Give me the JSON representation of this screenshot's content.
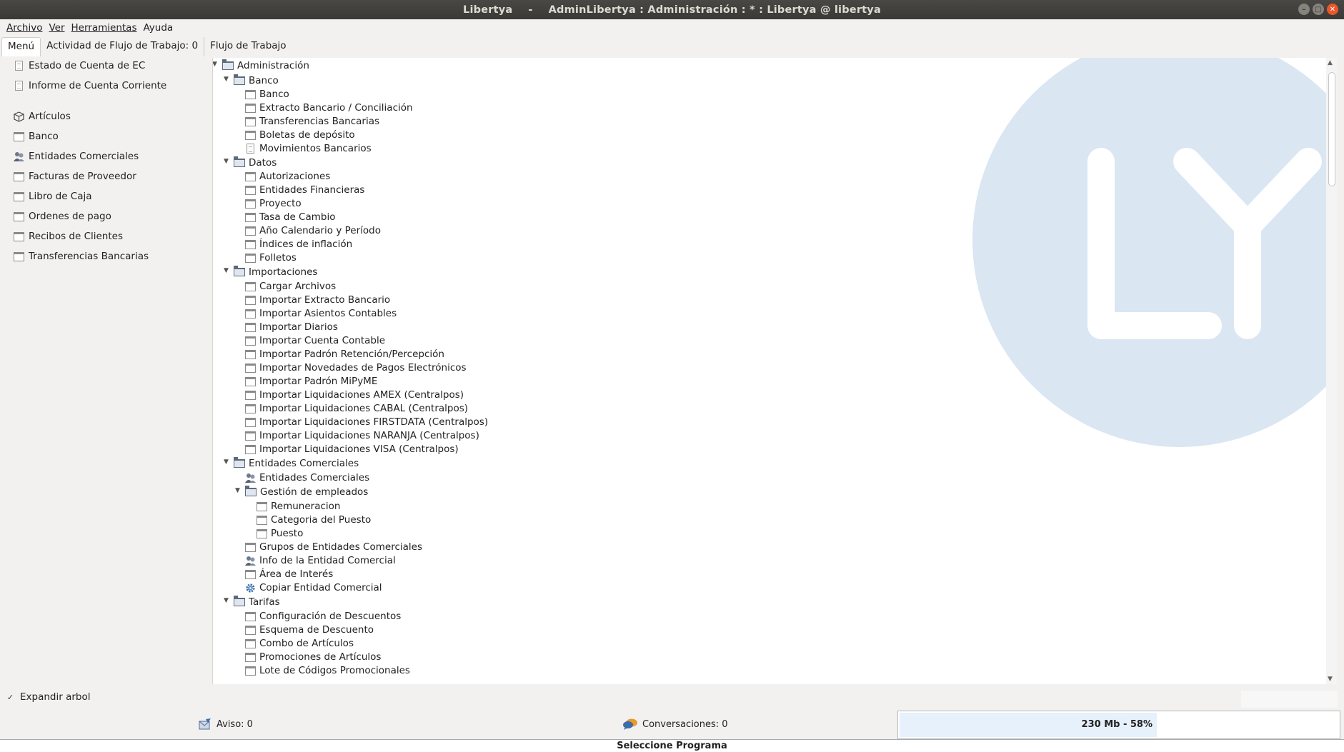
{
  "window": {
    "app": "Libertya",
    "separator": "-",
    "title": "AdminLibertya : Administración : * : Libertya @ libertya"
  },
  "menubar": [
    "Archivo",
    "Ver",
    "Herramientas",
    "Ayuda"
  ],
  "tabs": [
    "Menú",
    "Actividad de Flujo de Trabajo: 0",
    "Flujo de Trabajo"
  ],
  "left_panel": {
    "items": [
      {
        "label": "Estado de Cuenta de EC",
        "icon": "document-icon"
      },
      {
        "label": "Informe de Cuenta Corriente",
        "icon": "document-icon"
      },
      {
        "label": "Artículos",
        "icon": "box-icon"
      },
      {
        "label": "Banco",
        "icon": "window-icon"
      },
      {
        "label": "Entidades Comerciales",
        "icon": "people-icon"
      },
      {
        "label": "Facturas de Proveedor",
        "icon": "window-icon"
      },
      {
        "label": "Libro de Caja",
        "icon": "window-icon"
      },
      {
        "label": "Ordenes de pago",
        "icon": "window-icon"
      },
      {
        "label": "Recibos de Clientes",
        "icon": "window-icon"
      },
      {
        "label": "Transferencias Bancarias",
        "icon": "window-icon"
      }
    ]
  },
  "tree": {
    "watermark_letters": "LY",
    "nodes": [
      {
        "label": "Administración",
        "level": 0,
        "icon": "folder-icon",
        "expanded": true
      },
      {
        "label": "Banco",
        "level": 1,
        "icon": "folder-icon",
        "expanded": true
      },
      {
        "label": "Banco",
        "level": 2,
        "icon": "window-icon"
      },
      {
        "label": "Extracto Bancario / Conciliación",
        "level": 2,
        "icon": "window-icon"
      },
      {
        "label": "Transferencias Bancarias",
        "level": 2,
        "icon": "window-icon"
      },
      {
        "label": "Boletas de depósito",
        "level": 2,
        "icon": "window-icon"
      },
      {
        "label": "Movimientos Bancarios",
        "level": 2,
        "icon": "document-icon"
      },
      {
        "label": "Datos",
        "level": 1,
        "icon": "folder-icon",
        "expanded": true
      },
      {
        "label": "Autorizaciones",
        "level": 2,
        "icon": "window-icon"
      },
      {
        "label": "Entidades Financieras",
        "level": 2,
        "icon": "window-icon"
      },
      {
        "label": "Proyecto",
        "level": 2,
        "icon": "window-icon"
      },
      {
        "label": "Tasa de Cambio",
        "level": 2,
        "icon": "window-icon"
      },
      {
        "label": "Año Calendario y Período",
        "level": 2,
        "icon": "window-icon"
      },
      {
        "label": "Índices de inflación",
        "level": 2,
        "icon": "window-icon"
      },
      {
        "label": "Folletos",
        "level": 2,
        "icon": "window-icon"
      },
      {
        "label": "Importaciones",
        "level": 1,
        "icon": "folder-icon",
        "expanded": true
      },
      {
        "label": "Cargar Archivos",
        "level": 2,
        "icon": "window-icon"
      },
      {
        "label": "Importar Extracto Bancario",
        "level": 2,
        "icon": "window-icon"
      },
      {
        "label": "Importar Asientos Contables",
        "level": 2,
        "icon": "window-icon"
      },
      {
        "label": "Importar Diarios",
        "level": 2,
        "icon": "window-icon"
      },
      {
        "label": "Importar Cuenta Contable",
        "level": 2,
        "icon": "window-icon"
      },
      {
        "label": "Importar Padrón Retención/Percepción",
        "level": 2,
        "icon": "window-icon"
      },
      {
        "label": "Importar Novedades de Pagos Electrónicos",
        "level": 2,
        "icon": "window-icon"
      },
      {
        "label": "Importar Padrón MiPyME",
        "level": 2,
        "icon": "window-icon"
      },
      {
        "label": "Importar Liquidaciones AMEX (Centralpos)",
        "level": 2,
        "icon": "window-icon"
      },
      {
        "label": "Importar Liquidaciones CABAL (Centralpos)",
        "level": 2,
        "icon": "window-icon"
      },
      {
        "label": "Importar Liquidaciones FIRSTDATA (Centralpos)",
        "level": 2,
        "icon": "window-icon"
      },
      {
        "label": "Importar Liquidaciones NARANJA (Centralpos)",
        "level": 2,
        "icon": "window-icon"
      },
      {
        "label": "Importar Liquidaciones VISA (Centralpos)",
        "level": 2,
        "icon": "window-icon"
      },
      {
        "label": "Entidades Comerciales",
        "level": 1,
        "icon": "folder-icon",
        "expanded": true
      },
      {
        "label": "Entidades Comerciales",
        "level": 2,
        "icon": "people-icon"
      },
      {
        "label": "Gestión de empleados",
        "level": 2,
        "icon": "folder-icon",
        "expanded": true
      },
      {
        "label": "Remuneracion",
        "level": 3,
        "icon": "window-icon"
      },
      {
        "label": "Categoria del Puesto",
        "level": 3,
        "icon": "window-icon"
      },
      {
        "label": "Puesto",
        "level": 3,
        "icon": "window-icon"
      },
      {
        "label": "Grupos de Entidades Comerciales",
        "level": 2,
        "icon": "window-icon"
      },
      {
        "label": "Info de la Entidad Comercial",
        "level": 2,
        "icon": "people-icon"
      },
      {
        "label": "Área de Interés",
        "level": 2,
        "icon": "window-icon"
      },
      {
        "label": "Copiar Entidad Comercial",
        "level": 2,
        "icon": "gear-icon"
      },
      {
        "label": "Tarifas",
        "level": 1,
        "icon": "folder-icon",
        "expanded": true
      },
      {
        "label": "Configuración de Descuentos",
        "level": 2,
        "icon": "window-icon"
      },
      {
        "label": "Esquema de Descuento",
        "level": 2,
        "icon": "window-icon"
      },
      {
        "label": "Combo de Artículos",
        "level": 2,
        "icon": "window-icon"
      },
      {
        "label": "Promociones de Artículos",
        "level": 2,
        "icon": "window-icon"
      },
      {
        "label": "Lote de Códigos Promocionales",
        "level": 2,
        "icon": "window-icon"
      }
    ]
  },
  "footer": {
    "expand_tree_label": "Expandir arbol",
    "expand_tree_checked": true,
    "aviso": "Aviso: 0",
    "conversaciones": "Conversaciones: 0",
    "memory": "230 Mb - 58%",
    "memory_fraction": 0.58,
    "program_prompt": "Seleccione Programa"
  },
  "colors": {
    "titlebar": "#3b3936",
    "watermark": "#dbe6f3",
    "close_button": "#e9572a",
    "memory_fill": "#e6f1fb"
  }
}
